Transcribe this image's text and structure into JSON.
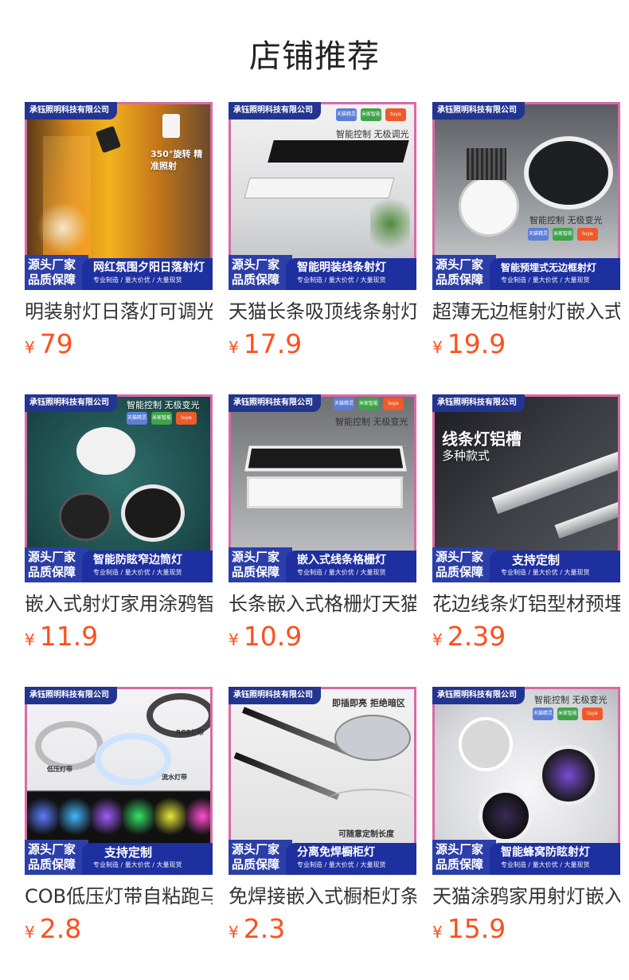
{
  "page_title": "店铺推荐",
  "currency_symbol": "¥",
  "products": [
    {
      "brand": "承钰照明科技有限公司",
      "name": "明装射灯日落灯可调光",
      "price": "79",
      "banner_left": [
        "源头厂家",
        "品质保障"
      ],
      "banner_main": "网红氛围夕阳日落射灯",
      "banner_sub": "专业制造 / 量大价优 / 大量现货",
      "image_caption": "350°旋转 精准照射"
    },
    {
      "brand": "承钰照明科技有限公司",
      "name": "天猫长条吸顶线条射灯",
      "price": "17.9",
      "banner_left": [
        "源头厂家",
        "品质保障"
      ],
      "banner_main": "智能明装线条射灯",
      "banner_sub": "专业制造 / 量大价优 / 大量现货",
      "image_caption": "智能控制 无极调光",
      "badges": [
        "天猫精灵",
        "米家智能",
        "tuya"
      ]
    },
    {
      "brand": "承钰照明科技有限公司",
      "name": "超薄无边框射灯嵌入式",
      "price": "19.9",
      "banner_left": [
        "源头厂家",
        "品质保障"
      ],
      "banner_main": "智能预埋式无边框射灯",
      "banner_sub": "专业制造 / 量大价优 / 大量现货",
      "image_caption": "智能控制 无极变光",
      "badges": [
        "天猫精灵",
        "米家智能",
        "tuya"
      ]
    },
    {
      "brand": "承钰照明科技有限公司",
      "name": "嵌入式射灯家用涂鸦智能",
      "price": "11.9",
      "banner_left": [
        "源头厂家",
        "品质保障"
      ],
      "banner_main": "智能防眩窄边筒灯",
      "banner_sub": "专业制造 / 量大价优 / 大量现货",
      "image_caption": "智能控制 无极变光",
      "badges": [
        "天猫精灵",
        "米家智能",
        "tuya"
      ]
    },
    {
      "brand": "承钰照明科技有限公司",
      "name": "长条嵌入式格栅灯天猫",
      "price": "10.9",
      "banner_left": [
        "源头厂家",
        "品质保障"
      ],
      "banner_main": "嵌入式线条格栅灯",
      "banner_sub": "专业制造 / 量大价优 / 大量现货",
      "image_caption": "智能控制 无极变光",
      "badges": [
        "天猫精灵",
        "米家智能",
        "tuya"
      ]
    },
    {
      "brand": "承钰照明科技有限公司",
      "name": "花边线条灯铝型材预埋",
      "price": "2.39",
      "banner_left": [
        "源头厂家",
        "品质保障"
      ],
      "banner_main": "支持定制",
      "banner_sub": "专业制造 / 量大价优 / 大量现货",
      "image_caption": "线条灯铝槽",
      "image_caption2": "多种款式"
    },
    {
      "brand": "承钰照明科技有限公司",
      "name": "COB低压灯带自粘跑马",
      "price": "2.8",
      "banner_left": [
        "源头厂家",
        "品质保障"
      ],
      "banner_main": "支持定制",
      "banner_sub": "专业制造 / 量大价优 / 大量现货",
      "image_caption": "RGB灯带",
      "image_caption2": "低压灯带",
      "image_caption3": "流水灯带"
    },
    {
      "brand": "承钰照明科技有限公司",
      "name": "免焊接嵌入式橱柜灯条",
      "price": "2.3",
      "banner_left": [
        "源头厂家",
        "品质保障"
      ],
      "banner_main": "分离免焊橱柜灯",
      "banner_sub": "专业制造 / 量大价优 / 大量现货",
      "image_caption": "即插即亮 拒绝暗区",
      "image_caption2": "可随意定制长度"
    },
    {
      "brand": "承钰照明科技有限公司",
      "name": "天猫涂鸦家用射灯嵌入式",
      "price": "15.9",
      "banner_left": [
        "源头厂家",
        "品质保障"
      ],
      "banner_main": "智能蜂窝防眩射灯",
      "banner_sub": "专业制造 / 量大价优 / 大量现货",
      "image_caption": "智能控制 无极变光",
      "badges": [
        "天猫精灵",
        "米家智能",
        "tuya"
      ]
    }
  ]
}
